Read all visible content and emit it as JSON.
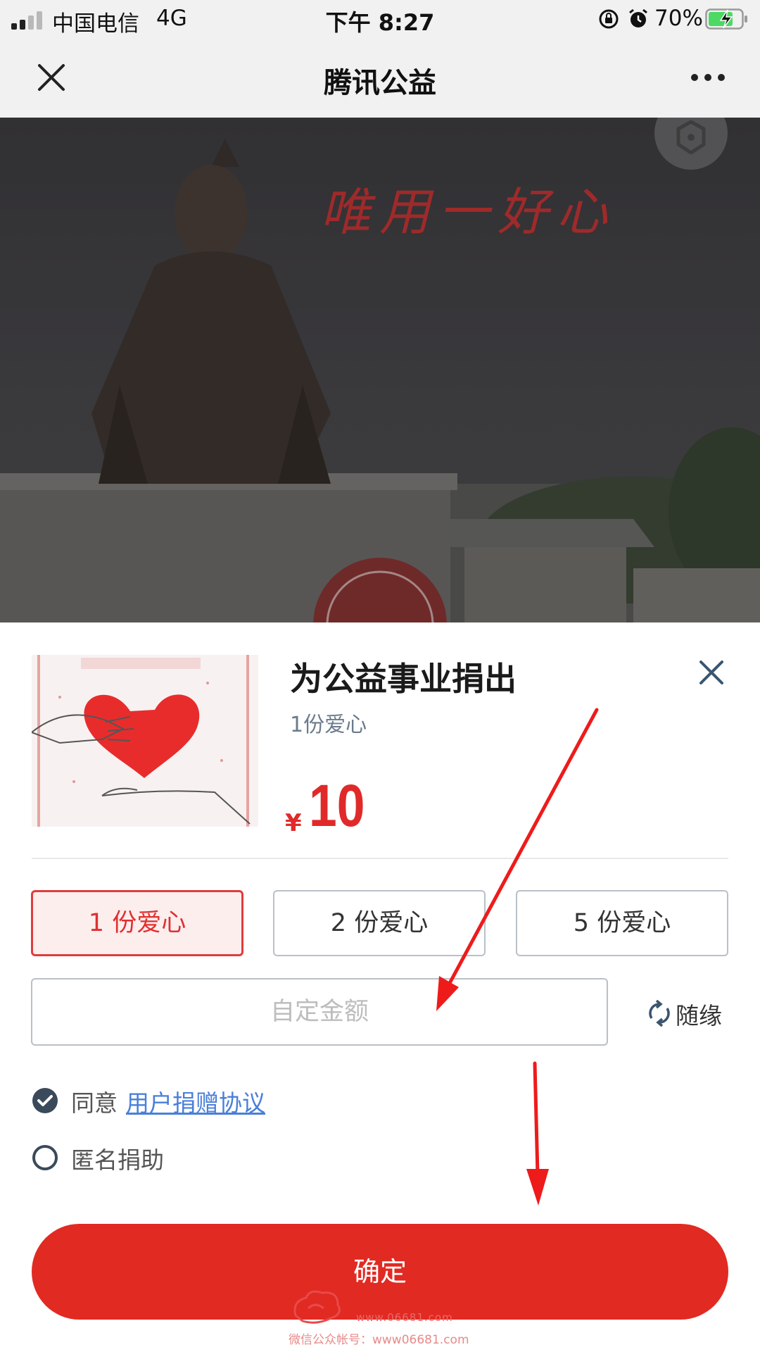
{
  "status_bar": {
    "carrier": "中国电信",
    "network": "4G",
    "time": "下午 8:27",
    "battery": "70%"
  },
  "nav": {
    "title": "腾讯公益"
  },
  "hero": {
    "calligraphy": "唯用一好心"
  },
  "sheet": {
    "title": "为公益事业捐出",
    "subtitle": "1份爱心",
    "price_symbol": "¥",
    "price_value": "10",
    "options": [
      "1 份爱心",
      "2 份爱心",
      "5 份爱心"
    ],
    "selected_option_index": 0,
    "custom_amount_placeholder": "自定金额",
    "random_label": "随缘",
    "agree_prefix": "同意",
    "agree_link": "用户捐赠协议",
    "agree_checked": true,
    "anonymous_label": "匿名捐助",
    "anonymous_checked": false,
    "confirm_label": "确定"
  },
  "watermark": {
    "url": "www.06681.com",
    "sub": "微信公众帐号：www06681.com"
  },
  "colors": {
    "accent_red": "#e12a22",
    "link_blue": "#4a7fd9",
    "check_dark": "#3a4a5a"
  },
  "icons": {
    "nav_close": "close-icon",
    "nav_more": "more-dots-icon",
    "sheet_close": "close-icon",
    "random": "refresh-icon",
    "agree": "check-circle-icon",
    "anonymous": "radio-empty-icon"
  }
}
